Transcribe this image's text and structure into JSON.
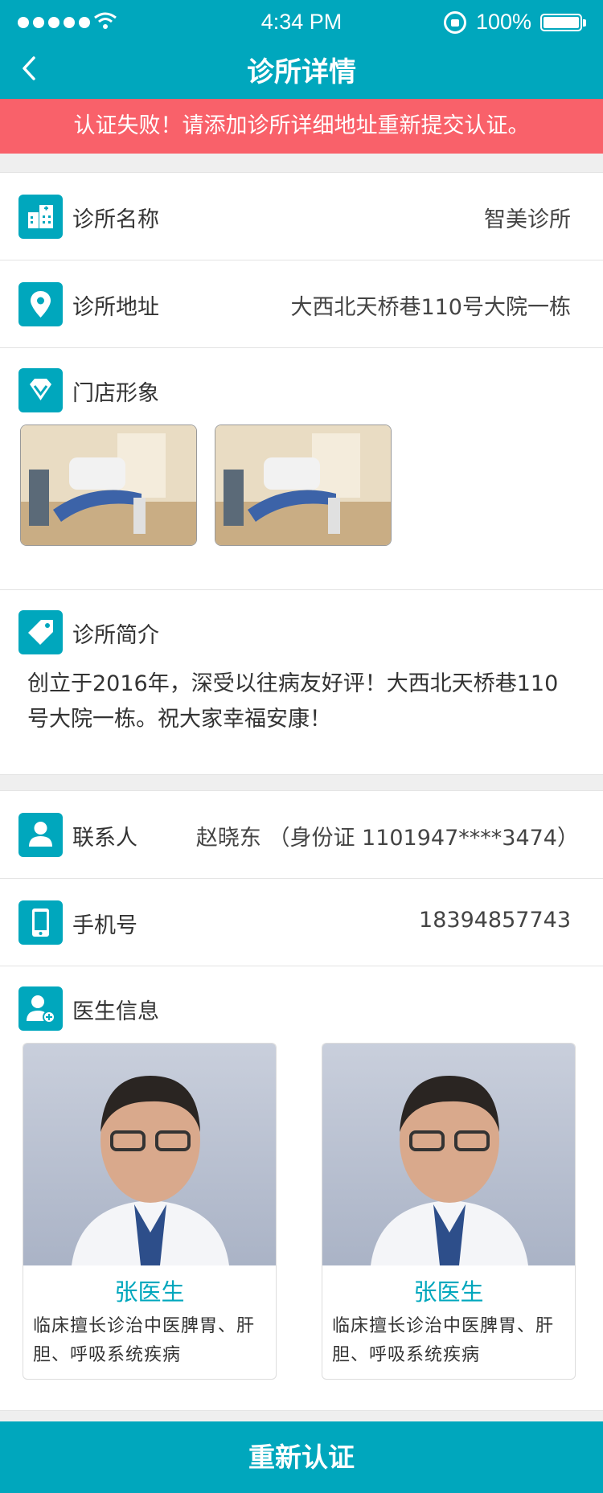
{
  "status_bar": {
    "time": "4:34 PM",
    "battery": "100%"
  },
  "nav": {
    "title": "诊所详情"
  },
  "alert": "认证失败！请添加诊所详细地址重新提交认证。",
  "clinic": {
    "name_label": "诊所名称",
    "name_value": "智美诊所",
    "address_label": "诊所地址",
    "address_value": "大西北天桥巷110号大院一栋",
    "store_label": "门店形象",
    "intro_label": "诊所简介",
    "intro_text": "创立于2016年，深受以往病友好评！大西北天桥巷110号大院一栋。祝大家幸福安康！"
  },
  "contact": {
    "person_label": "联系人",
    "person_value": "赵晓东 （身份证 1101947****3474）",
    "phone_label": "手机号",
    "phone_value": "18394857743",
    "doctors_label": "医生信息"
  },
  "doctors": [
    {
      "name": "张医生",
      "desc": "临床擅长诊治中医脾胃、肝胆、呼吸系统疾病"
    },
    {
      "name": "张医生",
      "desc": "临床擅长诊治中医脾胃、肝胆、呼吸系统疾病"
    }
  ],
  "action": {
    "label": "重新认证"
  },
  "colors": {
    "primary": "#00a7bd",
    "alert": "#f9616a"
  }
}
